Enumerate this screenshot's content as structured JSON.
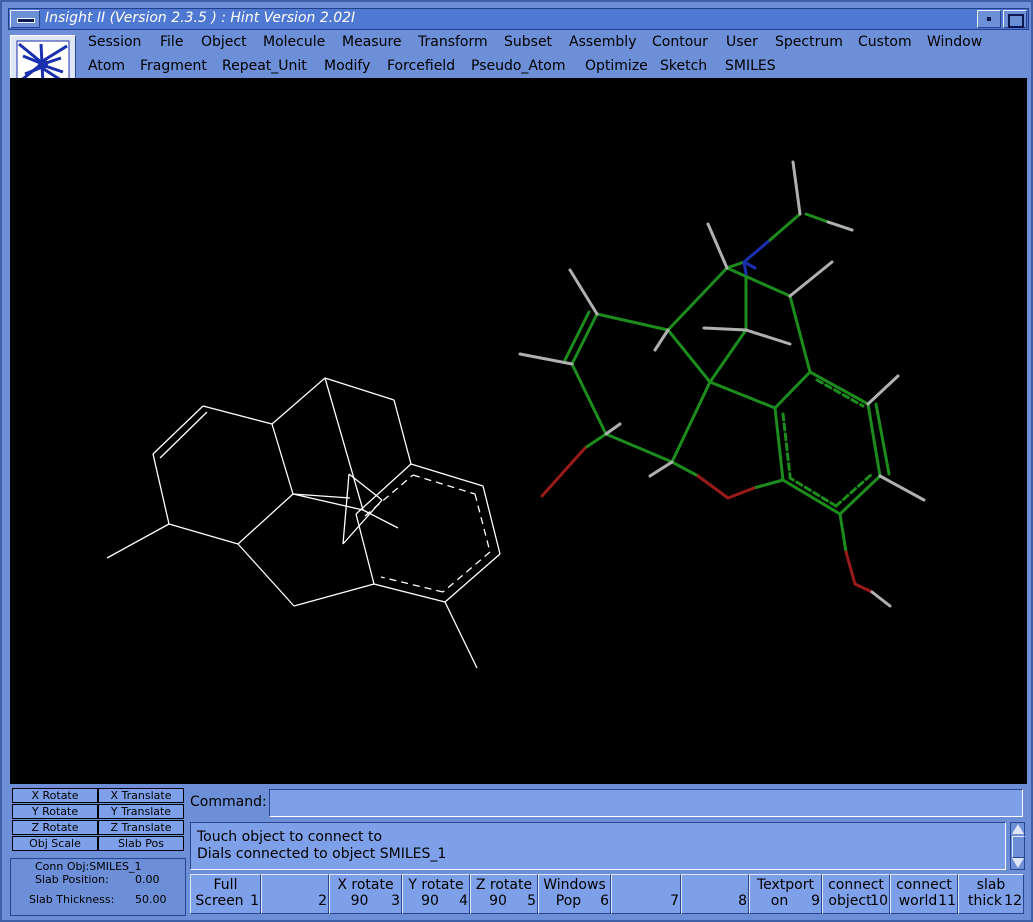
{
  "window": {
    "title": "Insight II (Version 2.3.5 ) : Hint  Version 2.02I"
  },
  "menu_row1": [
    "Session",
    "File",
    "Object",
    "Molecule",
    "Measure",
    "Transform",
    "Subset",
    "Assembly",
    "Contour",
    "User",
    "Spectrum",
    "Custom",
    "Window"
  ],
  "menu_row2": [
    "Atom",
    "Fragment",
    "Repeat_Unit",
    "Modify",
    "Forcefield",
    "Pseudo_Atom",
    "Optimize",
    "Sketch",
    "SMILES"
  ],
  "colors": {
    "chrome": "#6d8fd8",
    "viewport": "#000000",
    "bond_white": "#ffffff",
    "carbon": "#1c8c1c",
    "hydrogen": "#b0b0b0",
    "nitrogen": "#1a2fb0",
    "oxygen": "#9a1a1a"
  },
  "dials": [
    {
      "label": "X Rotate"
    },
    {
      "label": "X Translate"
    },
    {
      "label": "Y Rotate"
    },
    {
      "label": "Y Translate"
    },
    {
      "label": "Z Rotate"
    },
    {
      "label": "Z Translate"
    },
    {
      "label": "Obj Scale"
    },
    {
      "label": "Slab Pos"
    }
  ],
  "info": {
    "conn_obj": "Conn Obj:SMILES_1",
    "slab_position_label": "Slab Position:",
    "slab_position_value": "0.00",
    "slab_thickness_label": "Slab Thickness:",
    "slab_thickness_value": "50.00"
  },
  "command": {
    "label": "Command:",
    "value": ""
  },
  "messages": [
    "Touch object to connect to",
    "Dials connected to object SMILES_1"
  ],
  "function_keys": [
    {
      "line1": "Full",
      "line2": "Screen",
      "num": "1"
    },
    {
      "line1": "",
      "line2": "",
      "num": "2"
    },
    {
      "line1": "X rotate",
      "line2": "90",
      "num": "3"
    },
    {
      "line1": "Y rotate",
      "line2": "90",
      "num": "4"
    },
    {
      "line1": "Z rotate",
      "line2": "90",
      "num": "5"
    },
    {
      "line1": "Windows",
      "line2": "Pop",
      "num": "6"
    },
    {
      "line1": "",
      "line2": "",
      "num": "7"
    },
    {
      "line1": "",
      "line2": "",
      "num": "8"
    },
    {
      "line1": "Textport",
      "line2": "on",
      "num": "9"
    },
    {
      "line1": "connect",
      "line2": "object",
      "num": "10"
    },
    {
      "line1": "connect",
      "line2": "world",
      "num": "11"
    },
    {
      "line1": "slab",
      "line2": "thick",
      "num": "12"
    }
  ]
}
